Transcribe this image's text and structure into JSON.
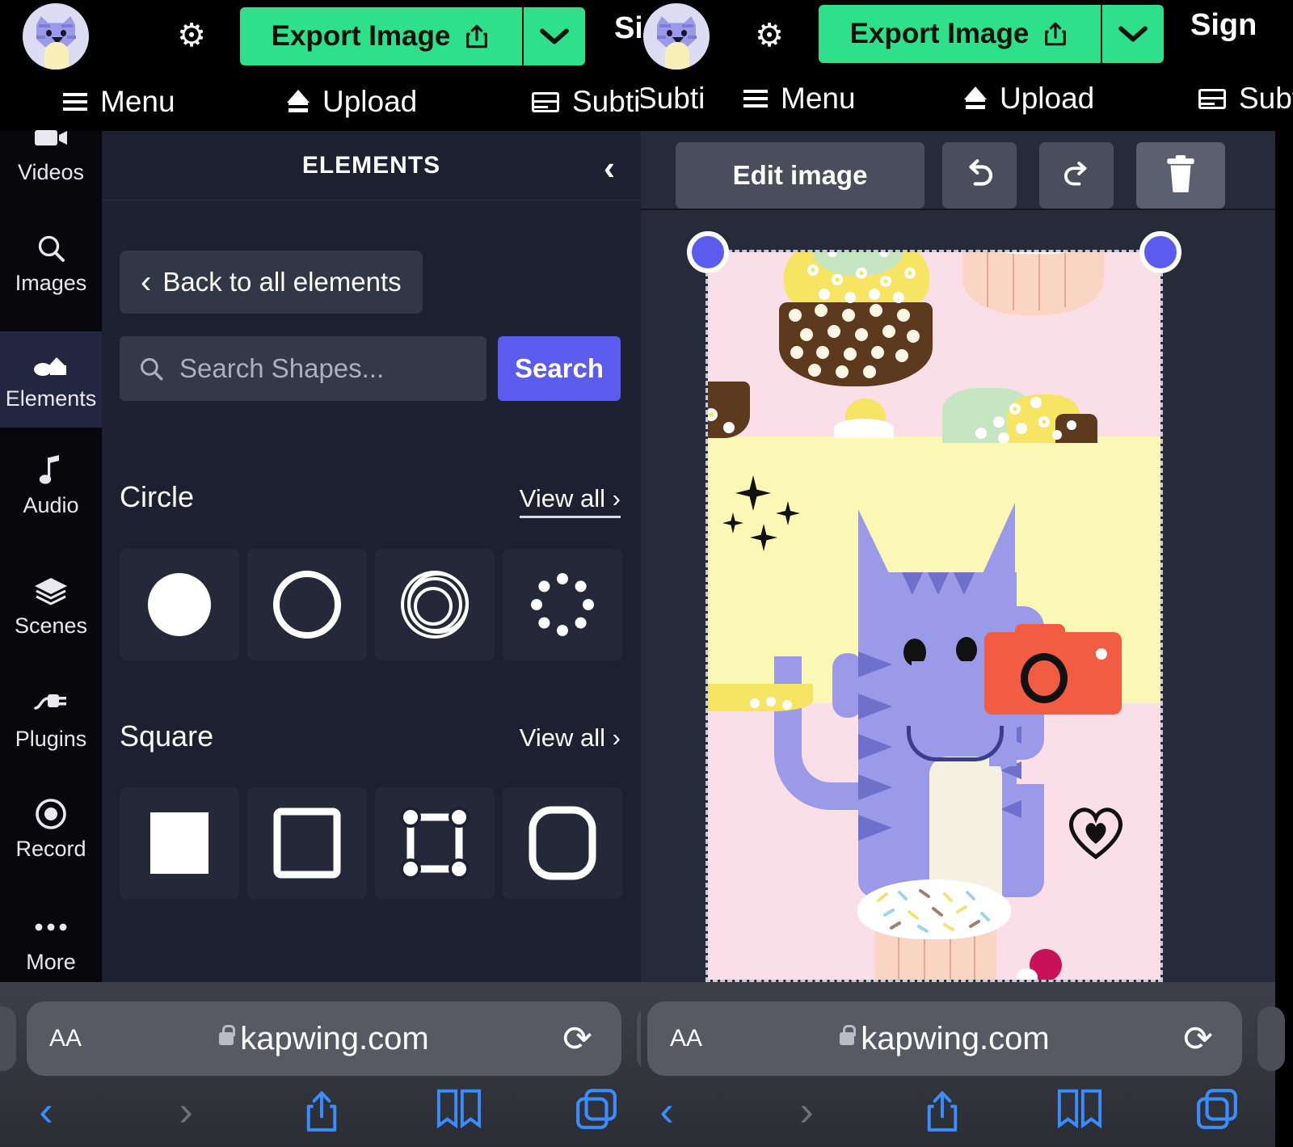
{
  "app": {
    "brand_avatar": "cat-avatar",
    "export_label": "Export Image",
    "export_caret": "⌄",
    "signin_label": "Sign",
    "signin_label_full": "Sign In",
    "settings_icon": "gear-icon",
    "share_icon": "share-icon"
  },
  "toolbar": {
    "menu_label": "Menu",
    "upload_label": "Upload",
    "subtitles_label": "Subtitles",
    "subtitles_label_clipped": "Subti"
  },
  "rail": {
    "items": [
      {
        "label": "Videos",
        "icon": "video-icon",
        "active": false
      },
      {
        "label": "Images",
        "icon": "search-icon",
        "active": false
      },
      {
        "label": "Elements",
        "icon": "shapes-icon",
        "active": true
      },
      {
        "label": "Audio",
        "icon": "music-note-icon",
        "active": false
      },
      {
        "label": "Scenes",
        "icon": "layers-icon",
        "active": false
      },
      {
        "label": "Plugins",
        "icon": "plug-icon",
        "active": false
      },
      {
        "label": "Record",
        "icon": "record-icon",
        "active": false
      },
      {
        "label": "More",
        "icon": "ellipsis-icon",
        "active": false
      }
    ]
  },
  "elements_panel": {
    "title": "ELEMENTS",
    "collapse_icon": "chevron-left-icon",
    "back_label": "Back to all elements",
    "search_placeholder": "Search Shapes...",
    "search_value": "",
    "search_button": "Search",
    "sections": [
      {
        "title": "Circle",
        "view_all": "View all ›",
        "tiles": [
          "filled-circle",
          "outline-circle",
          "concentric-circles",
          "dotted-circle"
        ]
      },
      {
        "title": "Square",
        "view_all": "View all ›",
        "tiles": [
          "filled-square",
          "outline-square",
          "node-square",
          "rounded-square"
        ]
      }
    ]
  },
  "editor": {
    "edit_image_label": "Edit image",
    "undo_icon": "undo-icon",
    "redo_icon": "redo-icon",
    "delete_icon": "trash-icon",
    "selection_handles": 2,
    "canvas": {
      "background_pink": "#fbdfe8",
      "background_yellow": "#fbf7b5",
      "subject": "cat-with-camera",
      "cat_color": "#9a9ae8",
      "cat_stripe_color": "#6f6fcc",
      "camera_color": "#f25c42",
      "chest_color": "#f5f0e2",
      "accent_magenta": "#c9115a"
    }
  },
  "browser": {
    "text_size_label": "AA",
    "url": "kapwing.com",
    "secure_icon": "lock-icon",
    "reload_icon": "reload-icon",
    "back_icon": "chevron-left-icon",
    "forward_icon": "chevron-right-icon",
    "share_icon": "share-icon",
    "bookmarks_icon": "book-icon",
    "tabs_icon": "tabs-icon"
  },
  "colors": {
    "accent_green": "#2ee08a",
    "accent_blue": "#5b5bee",
    "panel_bg": "#1c2030",
    "editor_bg": "#272b39",
    "rail_bg": "#08080c"
  }
}
